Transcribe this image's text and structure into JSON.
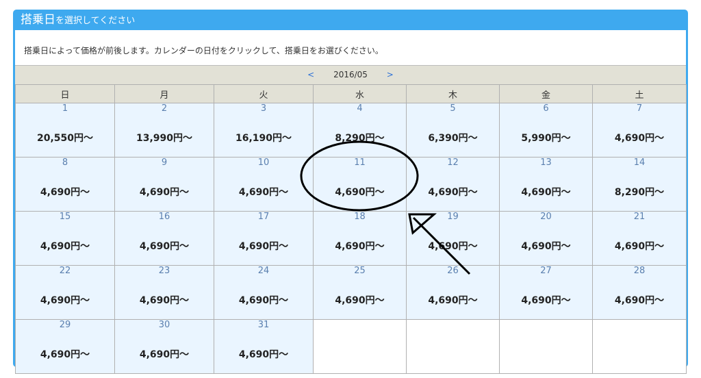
{
  "header": {
    "title_main": "搭乗日",
    "title_sub": "を選択してください"
  },
  "note": "搭乗日によって価格が前後します。カレンダーの日付をクリックして、搭乗日をお選びください。",
  "nav": {
    "prev": "<",
    "month": "2016/05",
    "next": ">"
  },
  "weekdays": [
    "日",
    "月",
    "火",
    "水",
    "木",
    "金",
    "土"
  ],
  "weeks": [
    [
      {
        "day": "1",
        "price": "20,550円～"
      },
      {
        "day": "2",
        "price": "13,990円～"
      },
      {
        "day": "3",
        "price": "16,190円～"
      },
      {
        "day": "4",
        "price": "8,290円～"
      },
      {
        "day": "5",
        "price": "6,390円～"
      },
      {
        "day": "6",
        "price": "5,990円～"
      },
      {
        "day": "7",
        "price": "4,690円～"
      }
    ],
    [
      {
        "day": "8",
        "price": "4,690円～"
      },
      {
        "day": "9",
        "price": "4,690円～"
      },
      {
        "day": "10",
        "price": "4,690円～"
      },
      {
        "day": "11",
        "price": "4,690円～"
      },
      {
        "day": "12",
        "price": "4,690円～"
      },
      {
        "day": "13",
        "price": "4,690円～"
      },
      {
        "day": "14",
        "price": "8,290円～"
      }
    ],
    [
      {
        "day": "15",
        "price": "4,690円～"
      },
      {
        "day": "16",
        "price": "4,690円～"
      },
      {
        "day": "17",
        "price": "4,690円～"
      },
      {
        "day": "18",
        "price": "4,690円～"
      },
      {
        "day": "19",
        "price": "4,690円～"
      },
      {
        "day": "20",
        "price": "4,690円～"
      },
      {
        "day": "21",
        "price": "4,690円～"
      }
    ],
    [
      {
        "day": "22",
        "price": "4,690円～"
      },
      {
        "day": "23",
        "price": "4,690円～"
      },
      {
        "day": "24",
        "price": "4,690円～"
      },
      {
        "day": "25",
        "price": "4,690円～"
      },
      {
        "day": "26",
        "price": "4,690円～"
      },
      {
        "day": "27",
        "price": "4,690円～"
      },
      {
        "day": "28",
        "price": "4,690円～"
      }
    ],
    [
      {
        "day": "29",
        "price": "4,690円～"
      },
      {
        "day": "30",
        "price": "4,690円～"
      },
      {
        "day": "31",
        "price": "4,690円～"
      },
      null,
      null,
      null,
      null
    ]
  ],
  "colors": {
    "accent": "#3ea9ef",
    "day_cell": "#eaf5ff",
    "header_row": "#e2e1d6"
  }
}
